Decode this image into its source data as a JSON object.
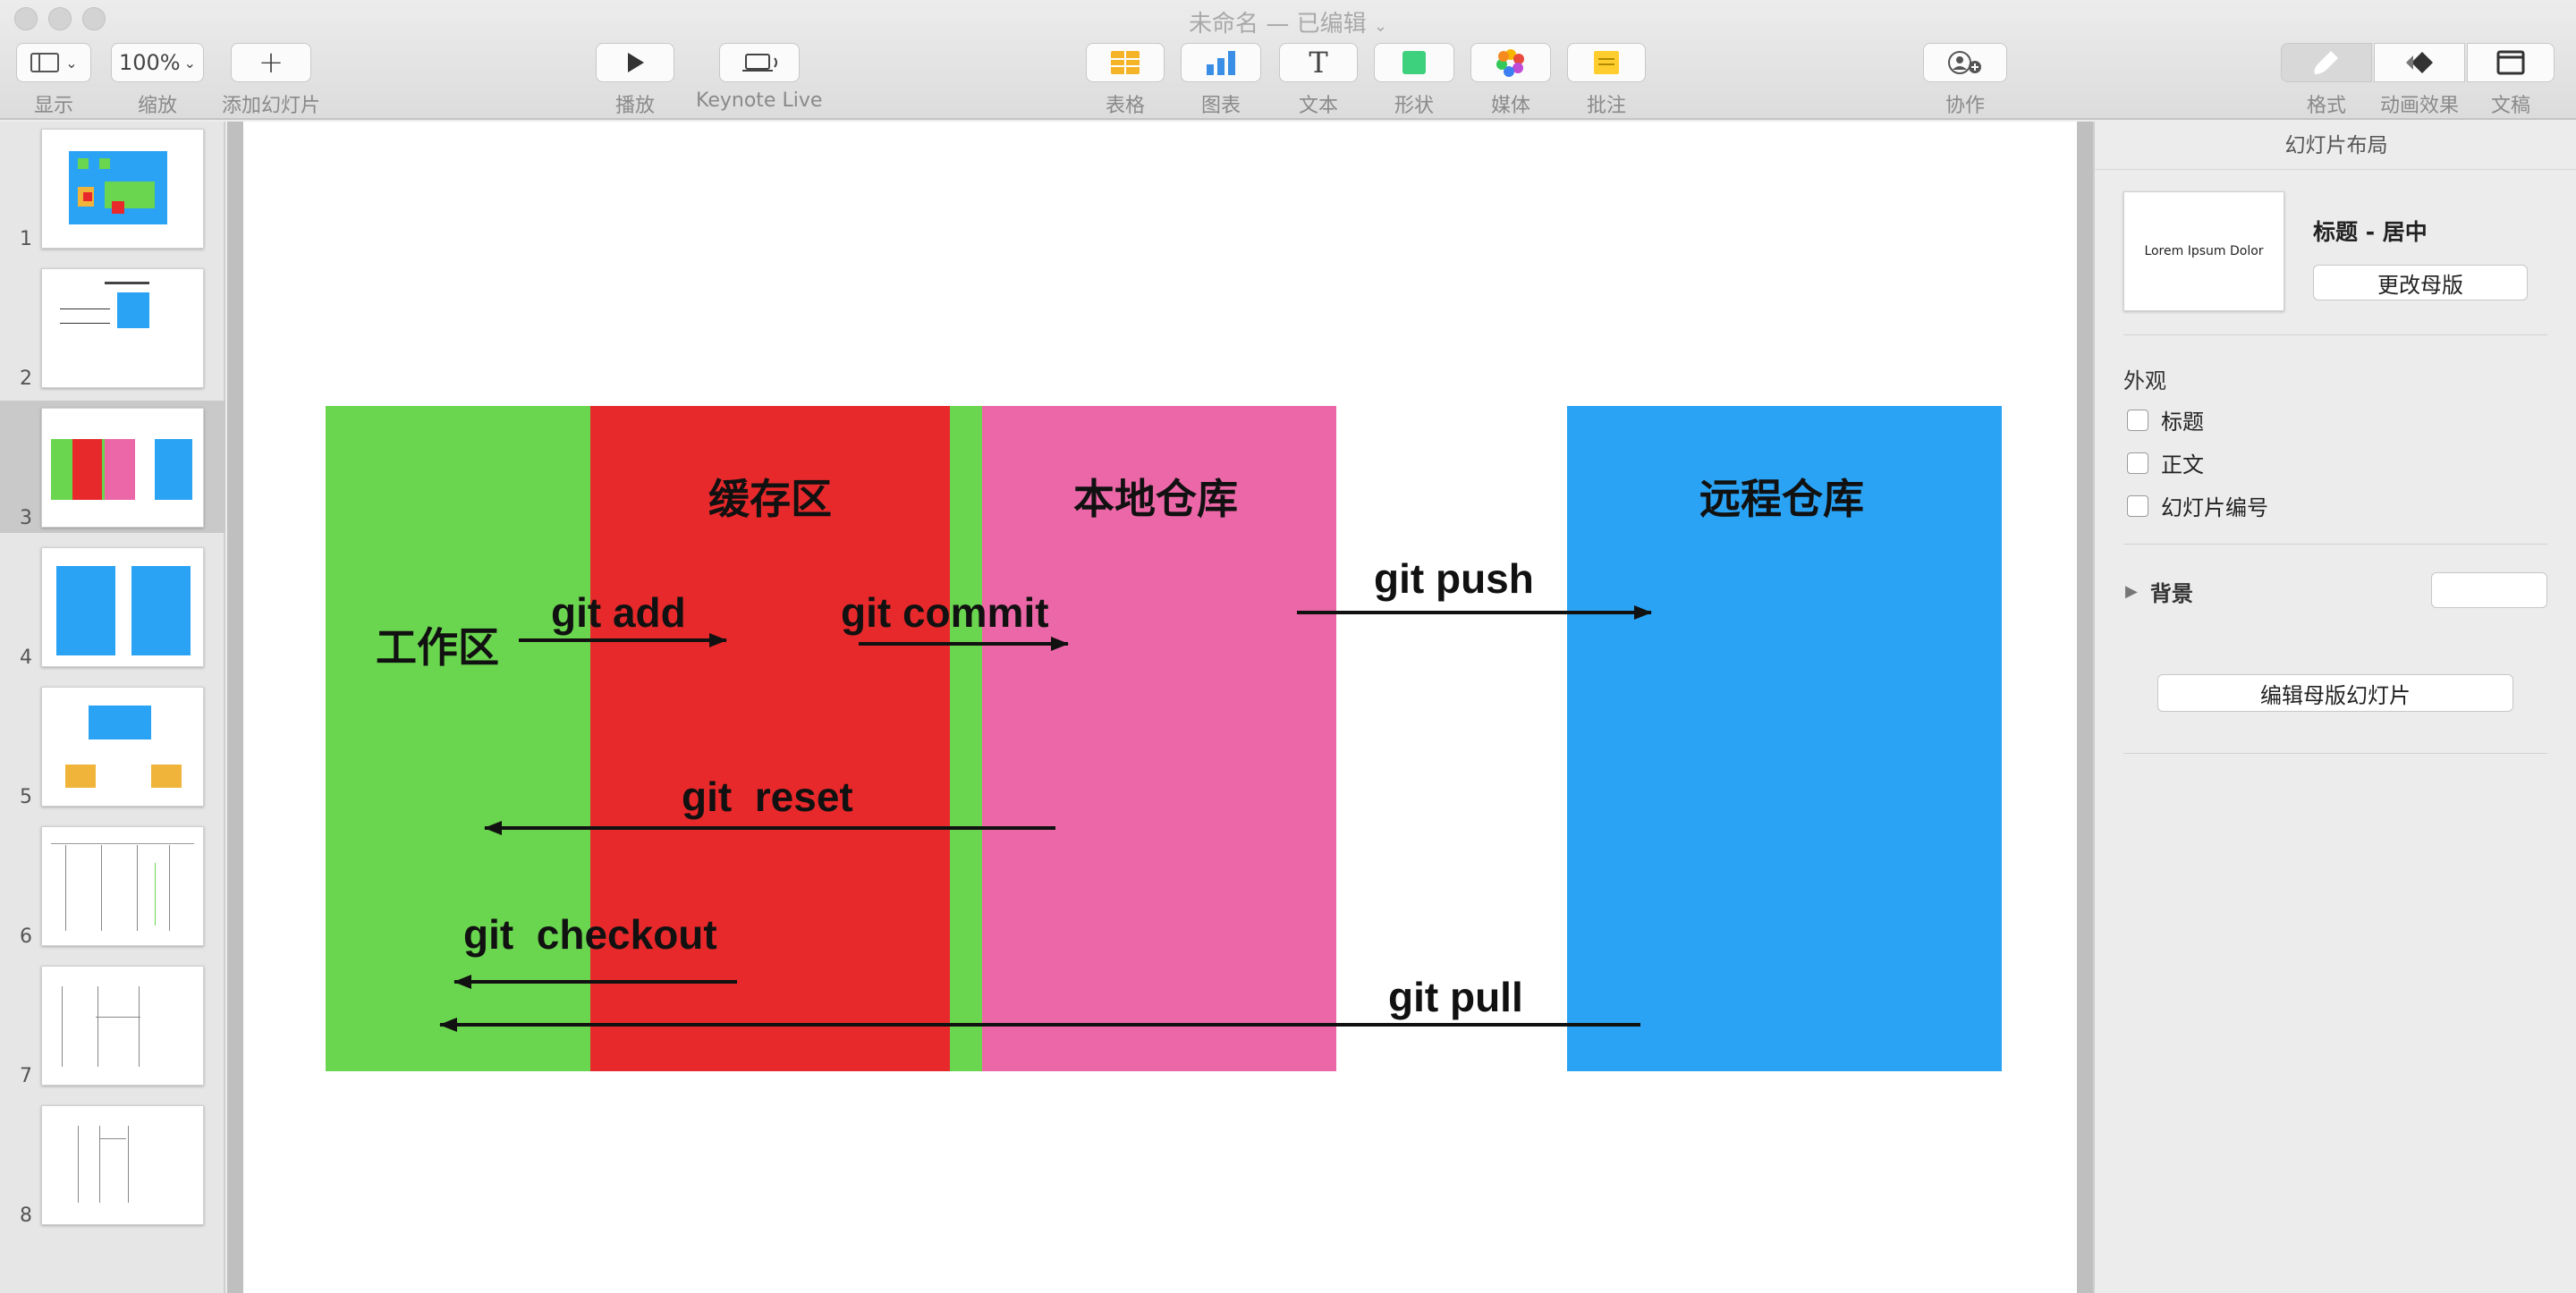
{
  "window": {
    "title": "未命名",
    "edit_status": "— 已编辑"
  },
  "toolbar": {
    "view_label": "显示",
    "zoom_value": "100%",
    "zoom_label": "缩放",
    "add_slide_label": "添加幻灯片",
    "play_label": "播放",
    "keynote_live_label": "Keynote Live",
    "table_label": "表格",
    "chart_label": "图表",
    "text_label": "文本",
    "shape_label": "形状",
    "media_label": "媒体",
    "comment_label": "批注",
    "collaborate_label": "协作",
    "format_label": "格式",
    "animate_label": "动画效果",
    "document_label": "文稿"
  },
  "navigator": {
    "slides": [
      "1",
      "2",
      "3",
      "4",
      "5",
      "6",
      "7",
      "8"
    ],
    "selected": "3"
  },
  "slide": {
    "colors": {
      "green": "#6ad54f",
      "red": "#e8292b",
      "pink": "#ec67a7",
      "blue": "#2aa3f5"
    },
    "labels": {
      "working": "工作区",
      "staging": "缓存区",
      "local": "本地仓库",
      "remote": "远程仓库",
      "git_add": "git add",
      "git_commit": "git commit",
      "git_push": "git push",
      "git_reset": "git  reset",
      "git_checkout": "git  checkout",
      "git_pull": "git pull"
    }
  },
  "inspector": {
    "title": "幻灯片布局",
    "layout_preview_text": "Lorem Ipsum Dolor",
    "layout_name": "标题 - 居中",
    "change_master_button": "更改母版",
    "appearance_label": "外观",
    "options": [
      "标题",
      "正文",
      "幻灯片编号"
    ],
    "background_label": "背景",
    "edit_master_button": "编辑母版幻灯片"
  }
}
